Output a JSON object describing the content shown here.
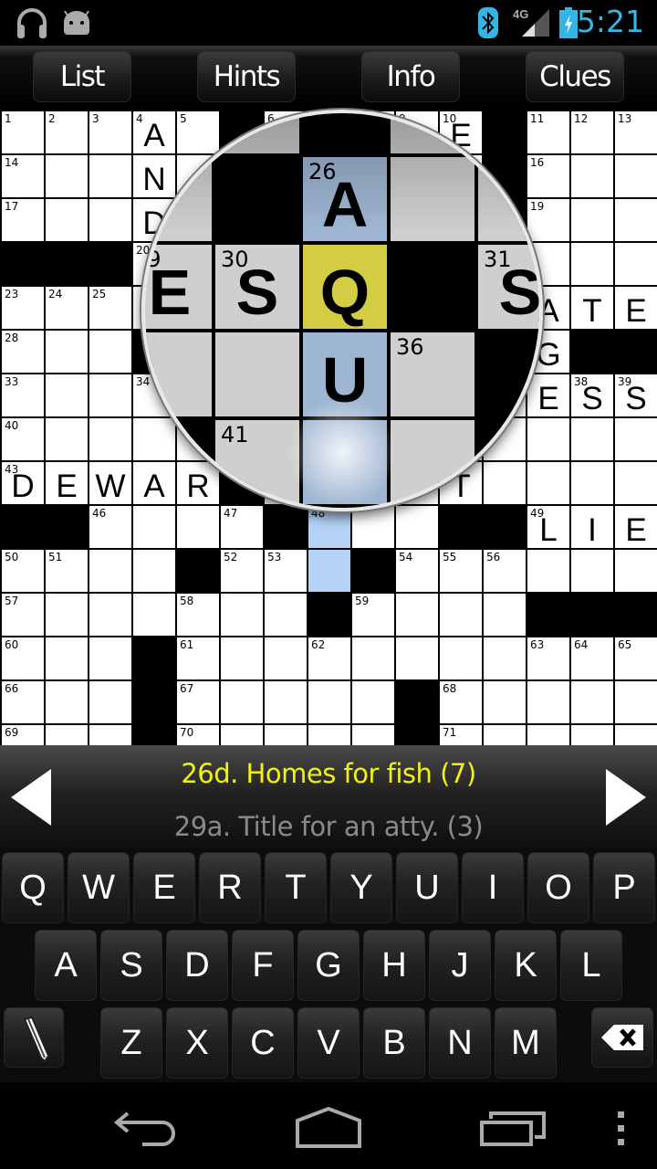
{
  "status": {
    "time": "5:21",
    "network": "4G",
    "accent_color": "#33b5e5",
    "icons": [
      "headphones-icon",
      "android-icon",
      "bluetooth-icon",
      "signal-icon",
      "battery-charging-icon"
    ]
  },
  "toolbar": {
    "buttons": [
      {
        "label": "List"
      },
      {
        "label": "Hints"
      },
      {
        "label": "Info"
      },
      {
        "label": "Clues"
      }
    ]
  },
  "grid": {
    "size": 15,
    "rows": [
      "...A.#....E#...",
      "...N.#.....#...",
      "...D.......#...",
      "###....#.......",
      "......#A..#.ATE",
      "...##ESQ#S..G##",
      ".......U.#..ESS",
      ".....#...#.....",
      "DEWAR#....T....",
      "##....#...##LIE",
      "....#...#......",
      ".......#....###",
      "...#...........",
      "...#.....#.....",
      "...#.....#....."
    ],
    "numbers": [
      [
        0,
        0,
        1
      ],
      [
        0,
        1,
        2
      ],
      [
        0,
        2,
        3
      ],
      [
        0,
        3,
        4
      ],
      [
        0,
        4,
        5
      ],
      [
        0,
        6,
        6
      ],
      [
        0,
        7,
        7
      ],
      [
        0,
        8,
        8
      ],
      [
        0,
        9,
        9
      ],
      [
        0,
        10,
        10
      ],
      [
        0,
        12,
        11
      ],
      [
        0,
        13,
        12
      ],
      [
        0,
        14,
        13
      ],
      [
        1,
        0,
        14
      ],
      [
        1,
        6,
        15
      ],
      [
        1,
        12,
        16
      ],
      [
        2,
        0,
        17
      ],
      [
        2,
        5,
        18
      ],
      [
        2,
        12,
        19
      ],
      [
        3,
        3,
        20
      ],
      [
        3,
        8,
        21
      ],
      [
        3,
        11,
        22
      ],
      [
        4,
        0,
        23
      ],
      [
        4,
        1,
        24
      ],
      [
        4,
        2,
        25
      ],
      [
        4,
        7,
        26
      ],
      [
        4,
        11,
        27
      ],
      [
        5,
        0,
        28
      ],
      [
        5,
        5,
        29
      ],
      [
        5,
        6,
        30
      ],
      [
        5,
        9,
        31
      ],
      [
        5,
        10,
        32
      ],
      [
        6,
        0,
        33
      ],
      [
        6,
        3,
        34
      ],
      [
        6,
        4,
        35
      ],
      [
        6,
        8,
        36
      ],
      [
        6,
        10,
        37
      ],
      [
        6,
        13,
        38
      ],
      [
        6,
        14,
        39
      ],
      [
        7,
        0,
        40
      ],
      [
        7,
        6,
        41
      ],
      [
        7,
        10,
        42
      ],
      [
        8,
        0,
        43
      ],
      [
        8,
        6,
        44
      ],
      [
        8,
        9,
        45
      ],
      [
        9,
        2,
        46
      ],
      [
        9,
        5,
        47
      ],
      [
        9,
        7,
        48
      ],
      [
        9,
        12,
        49
      ],
      [
        10,
        0,
        50
      ],
      [
        10,
        1,
        51
      ],
      [
        10,
        5,
        52
      ],
      [
        10,
        6,
        53
      ],
      [
        10,
        9,
        54
      ],
      [
        10,
        10,
        55
      ],
      [
        10,
        11,
        56
      ],
      [
        11,
        0,
        57
      ],
      [
        11,
        4,
        58
      ],
      [
        11,
        8,
        59
      ],
      [
        12,
        0,
        60
      ],
      [
        12,
        4,
        61
      ],
      [
        12,
        7,
        62
      ],
      [
        12,
        12,
        63
      ],
      [
        12,
        13,
        64
      ],
      [
        12,
        14,
        65
      ],
      [
        13,
        0,
        66
      ],
      [
        13,
        4,
        67
      ],
      [
        13,
        10,
        68
      ],
      [
        14,
        0,
        69
      ],
      [
        14,
        4,
        70
      ],
      [
        14,
        10,
        71
      ]
    ],
    "selected_cell": [
      5,
      7
    ],
    "active_word": {
      "column": 7,
      "rows": [
        4,
        10
      ]
    },
    "colors": {
      "selected": "#d6cf3e",
      "word": "#b5d3f7"
    }
  },
  "clues": {
    "current": "26d. Homes for fish (7)",
    "secondary": "29a. Title for an atty. (3)",
    "current_color": "#f2f20a"
  },
  "keyboard": {
    "rows": [
      [
        "Q",
        "W",
        "E",
        "R",
        "T",
        "Y",
        "U",
        "I",
        "O",
        "P"
      ],
      [
        "A",
        "S",
        "D",
        "F",
        "G",
        "H",
        "J",
        "K",
        "L"
      ],
      [
        "Z",
        "X",
        "C",
        "V",
        "B",
        "N",
        "M"
      ]
    ],
    "pencil_icon": "pencil-icon",
    "backspace_icon": "backspace-icon"
  },
  "navbar": {
    "icons": [
      "back-icon",
      "home-icon",
      "recent-apps-icon",
      "menu-icon"
    ]
  }
}
